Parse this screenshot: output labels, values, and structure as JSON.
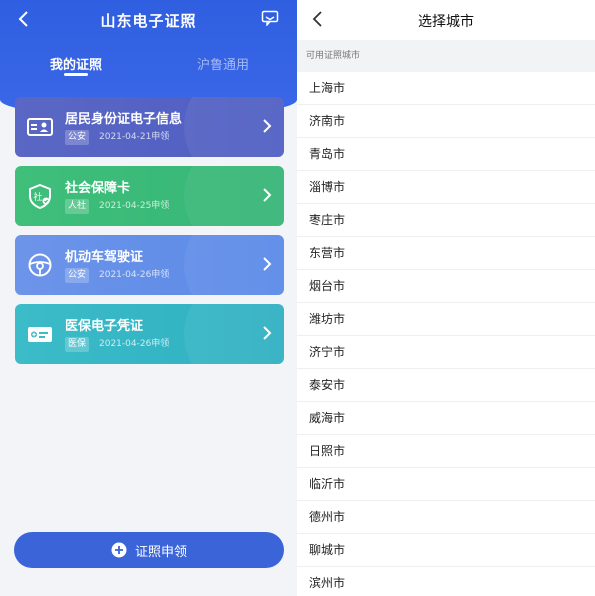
{
  "left": {
    "title": "山东电子证照",
    "tabs": [
      "我的证照",
      "沪鲁通用"
    ],
    "cards": [
      {
        "name": "居民身份证电子信息",
        "tag": "公安",
        "date": "2021-04-21申领",
        "icon": "id-card-icon"
      },
      {
        "name": "社会保障卡",
        "tag": "人社",
        "date": "2021-04-25申领",
        "icon": "social-security-icon"
      },
      {
        "name": "机动车驾驶证",
        "tag": "公安",
        "date": "2021-04-26申领",
        "icon": "steering-wheel-icon"
      },
      {
        "name": "医保电子凭证",
        "tag": "医保",
        "date": "2021-04-26申领",
        "icon": "medical-insurance-icon"
      }
    ],
    "apply_label": "证照申领"
  },
  "right": {
    "title": "选择城市",
    "section_label": "可用证照城市",
    "cities": [
      "上海市",
      "济南市",
      "青岛市",
      "淄博市",
      "枣庄市",
      "东营市",
      "烟台市",
      "潍坊市",
      "济宁市",
      "泰安市",
      "威海市",
      "日照市",
      "临沂市",
      "德州市",
      "聊城市",
      "滨州市"
    ]
  },
  "colors": {
    "header_blue": "#2f5fe0",
    "card_id": "#5a67c4",
    "card_social": "#3fbf7a",
    "card_driver": "#6d94e9",
    "card_medical": "#3cbcc8",
    "button": "#3a64d8"
  }
}
